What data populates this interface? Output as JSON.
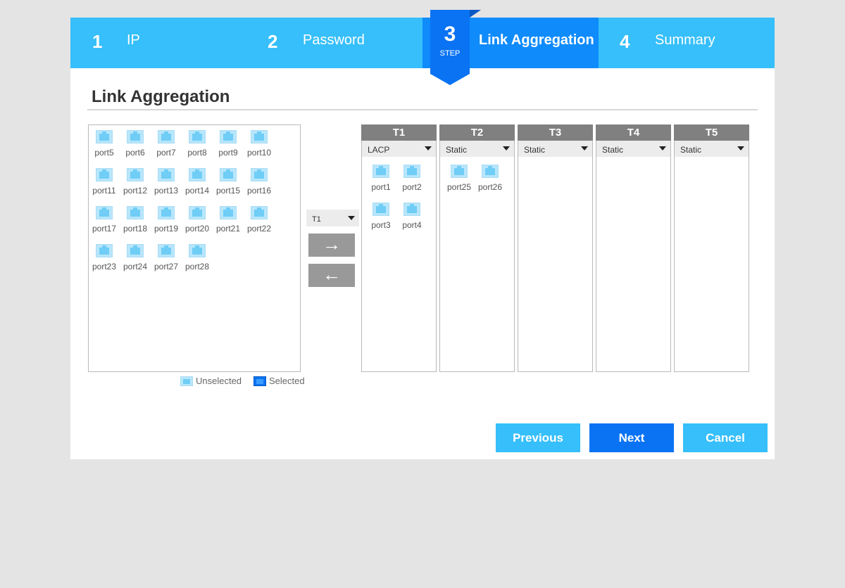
{
  "wizard": {
    "steps": [
      {
        "num": "1",
        "label": "IP"
      },
      {
        "num": "2",
        "label": "Password"
      },
      {
        "num": "3",
        "label": "Link Aggregation"
      },
      {
        "num": "4",
        "label": "Summary"
      }
    ],
    "active_step": "3",
    "step_word": "STEP"
  },
  "page": {
    "title": "Link Aggregation"
  },
  "pool": {
    "ports": [
      "port5",
      "port6",
      "port7",
      "port8",
      "port9",
      "port10",
      "port11",
      "port12",
      "port13",
      "port14",
      "port15",
      "port16",
      "port17",
      "port18",
      "port19",
      "port20",
      "port21",
      "port22",
      "port23",
      "port24",
      "port27",
      "port28"
    ]
  },
  "legend": {
    "unselected": "Unselected",
    "selected": "Selected"
  },
  "controls": {
    "target_trunk": "T1",
    "move_right": "→",
    "move_left": "←"
  },
  "trunks": [
    {
      "name": "T1",
      "mode": "LACP",
      "ports": [
        "port1",
        "port2",
        "port3",
        "port4"
      ]
    },
    {
      "name": "T2",
      "mode": "Static",
      "ports": [
        "port25",
        "port26"
      ]
    },
    {
      "name": "T3",
      "mode": "Static",
      "ports": []
    },
    {
      "name": "T4",
      "mode": "Static",
      "ports": []
    },
    {
      "name": "T5",
      "mode": "Static",
      "ports": []
    }
  ],
  "buttons": {
    "previous": "Previous",
    "next": "Next",
    "cancel": "Cancel"
  },
  "colors": {
    "header": "#36bffa",
    "active_step": "#0f8bfc",
    "primary": "#0a73f4",
    "trunk_header": "#808080",
    "port_icon": "#b8e6fb"
  }
}
